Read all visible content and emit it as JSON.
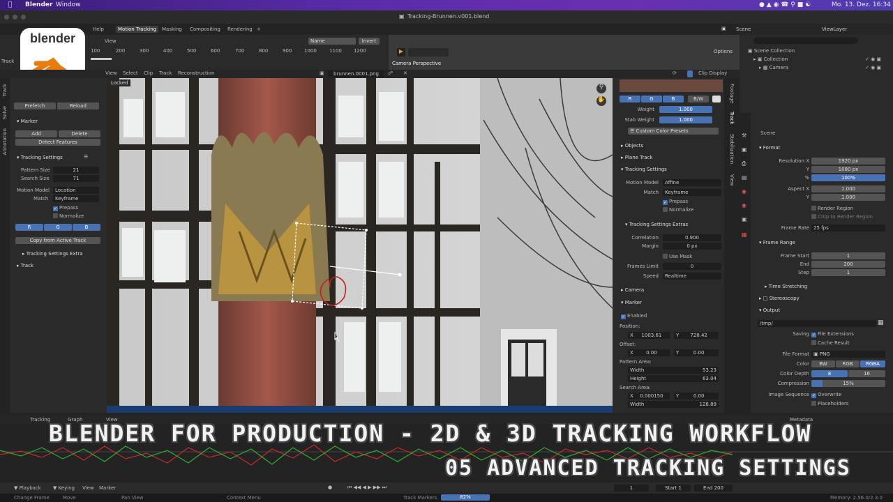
{
  "macbar": {
    "app": "Blender",
    "window": "Window",
    "clock": "Mo. 13. Dez. 16:34"
  },
  "titlebar": {
    "title": "Tracking-Brunnen.v001.blend"
  },
  "workspaces": {
    "help": "Help",
    "tabs": [
      "Motion Tracking",
      "Masking",
      "Compositing",
      "Rendering"
    ],
    "add": "+",
    "active": "Motion Tracking"
  },
  "logo": {
    "text": "blender"
  },
  "scene_header": {
    "scene": "Scene",
    "viewlayer": "ViewLayer"
  },
  "dopesheet": {
    "view": "View",
    "name": "Name",
    "invert": "Invert",
    "ticks": [
      "100",
      "200",
      "300",
      "400",
      "500",
      "600",
      "700",
      "800",
      "900",
      "1000",
      "1100",
      "1200"
    ],
    "left_label": "Track"
  },
  "camera_view": {
    "label": "Camera Perspective",
    "options": "Options"
  },
  "clip_header": {
    "menus": [
      "View",
      "Select",
      "Clip",
      "Track",
      "Reconstruction"
    ],
    "file": "brunnen.0001.png",
    "display": "Clip Display",
    "locked": "Locked"
  },
  "left_panel": {
    "tabs": [
      "Track",
      "Solve",
      "Annotation"
    ],
    "prefetch": "Prefetch",
    "reload": "Reload",
    "marker": "Marker",
    "add": "Add",
    "delete": "Delete",
    "detect": "Detect Features",
    "tracking_settings": "Tracking Settings",
    "pattern_size_label": "Pattern Size",
    "pattern_size": "21",
    "search_size_label": "Search Size",
    "search_size": "71",
    "motion_model_label": "Motion Model",
    "motion_model": "Location",
    "match_label": "Match",
    "match": "Keyframe",
    "prepass": "Prepass",
    "normalize": "Normalize",
    "r": "R",
    "g": "G",
    "b": "B",
    "copy": "Copy from Active Track",
    "extra": "Tracking Settings Extra",
    "track": "Track"
  },
  "props": {
    "tabs": [
      "Footage",
      "Track",
      "Stabilization",
      "View"
    ],
    "r": "R",
    "g": "G",
    "b": "B",
    "bw": "B/W",
    "weight_label": "Weight",
    "weight": "1.000",
    "stab_label": "Stab Weight",
    "stab": "1.000",
    "presets": "Custom Color Presets",
    "objects": "Objects",
    "plane_track": "Plane Track",
    "tracking_settings": "Tracking Settings",
    "motion_model_label": "Motion Model",
    "motion_model": "Affine",
    "match_label": "Match",
    "match": "Keyframe",
    "prepass": "Prepass",
    "normalize": "Normalize",
    "extras": "Tracking Settings Extras",
    "correlation_label": "Correlation",
    "correlation": "0.900",
    "margin_label": "Margin",
    "margin": "0 px",
    "use_mask": "Use Mask",
    "frames_limit_label": "Frames Limit",
    "frames_limit": "0",
    "speed_label": "Speed",
    "speed": "Realtime",
    "camera": "Camera",
    "marker": "Marker",
    "enabled": "Enabled",
    "position_label": "Position:",
    "pos_x": "1003.61",
    "pos_y": "728.42",
    "offset_label": "Offset:",
    "off_x": "0.00",
    "off_y": "0.00",
    "pattern_area_label": "Pattern Area:",
    "pat_w_label": "Width",
    "pat_w": "53.23",
    "pat_h_label": "Height",
    "pat_h": "63.04",
    "search_area_label": "Search Area:",
    "sa_x": "0.000150",
    "sa_y": "0.00",
    "sa_w_label": "Width",
    "sa_w": "128.89",
    "x": "X",
    "y": "Y"
  },
  "outliner": {
    "scene_collection": "Scene Collection",
    "collection": "Collection",
    "camera": "Camera"
  },
  "output_props": {
    "scene": "Scene",
    "format": "Format",
    "res_x_label": "Resolution X",
    "res_x": "1920 px",
    "res_y_label": "Y",
    "res_y": "1080 px",
    "res_pct_label": "%",
    "res_pct": "100%",
    "aspect_x_label": "Aspect X",
    "aspect_x": "1.000",
    "aspect_y_label": "Y",
    "aspect_y": "1.000",
    "render_region": "Render Region",
    "crop": "Crop to Render Region",
    "frame_rate_label": "Frame Rate",
    "frame_rate": "25 fps",
    "frame_range": "Frame Range",
    "start_label": "Frame Start",
    "start": "1",
    "end_label": "End",
    "end": "200",
    "step_label": "Step",
    "step": "1",
    "time_stretching": "Time Stretching",
    "stereoscopy": "Stereoscopy",
    "output": "Output",
    "path": "/tmp/",
    "saving_label": "Saving",
    "file_ext": "File Extensions",
    "cache": "Cache Result",
    "file_format_label": "File Format",
    "file_format": "PNG",
    "color_label": "Color",
    "bw": "BW",
    "rgb": "RGB",
    "rgba": "RGBA",
    "depth_label": "Color Depth",
    "depth8": "8",
    "depth16": "16",
    "compression_label": "Compression",
    "compression": "15%",
    "image_seq_label": "Image Sequence",
    "overwrite": "Overwrite",
    "placeholders": "Placeholders",
    "metadata": "Metadata"
  },
  "bottom": {
    "tracking": "Tracking",
    "graph": "Graph",
    "view": "View",
    "playback": "Playback",
    "keying": "Keying",
    "view2": "View",
    "marker": "Marker",
    "start": "Start",
    "start_val": "1",
    "end": "End",
    "end_val": "200",
    "frame": "1",
    "status": [
      "Change Frame",
      "Move",
      "Pan View",
      "Context Menu",
      "Track Markers"
    ],
    "progress": "82%",
    "version": "Memory: 2.56.0/2.3.0"
  },
  "overlay": {
    "line1": "BLENDER FOR PRODUCTION - 2D & 3D TRACKING WORKFLOW",
    "line2": "05 ADVANCED TRACKING SETTINGS"
  }
}
